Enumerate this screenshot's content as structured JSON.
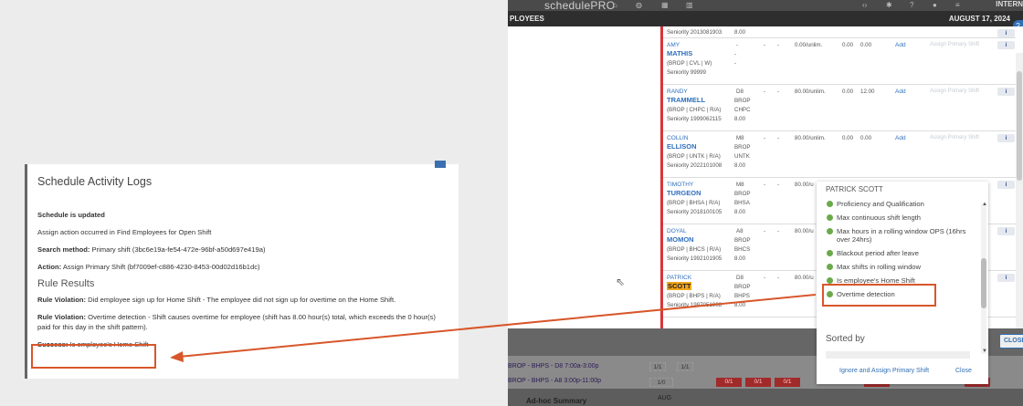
{
  "log": {
    "title": "Schedule Activity Logs",
    "updated": "Schedule is updated",
    "action_note": "Assign action occurred in Find Employees for Open Shift",
    "search_method_label": "Search method:",
    "search_method_value": "Primary shift (3bc6e19a-fe54-472e-96bf-a50d697e419a)",
    "action_label": "Action:",
    "action_value": "Assign Primary Shift (bf7009ef-c886-4230-8453-00d02d16b1dc)",
    "rule_results": "Rule Results",
    "v1_label": "Rule Violation:",
    "v1_text": "Did employee sign up for Home Shift - The employee did not sign up for overtime on the Home Shift.",
    "v2_label": "Rule Violation:",
    "v2_text": "Overtime detection - Shift causes overtime for employee (shift has 8.00 hour(s) total, which exceeds the 0 hour(s) paid for this day in the shift pattern).",
    "success_label": "Success:",
    "success_text": "Is employee's Home Shift"
  },
  "app": {
    "logo": "schedulePRO",
    "internal": "INTERN",
    "left_header": "PLOYEES",
    "date": "AUGUST 17, 2024",
    "help": "?"
  },
  "rows": [
    {
      "first": "",
      "last": "",
      "meta1": "Seniority 2013081903",
      "meta2": "",
      "c1": "",
      "c2": "8.00",
      "c3": "",
      "hours": "",
      "v1": "",
      "v2": "",
      "show_add": false
    },
    {
      "first": "AMY",
      "last": "MATHIS",
      "meta1": "(BROP | CVL | W)",
      "meta2": "Seniority 99999",
      "c1": "-",
      "c2": "-",
      "c3": "-",
      "hours": "0.00/unlim.",
      "v1": "0.00",
      "v2": "0.00",
      "show_add": true
    },
    {
      "first": "RANDY",
      "last": "TRAMMELL",
      "meta1": "(BROP | CHPC | R/A)",
      "meta2": "Seniority 1999062115",
      "c1": "D8",
      "c2": "BROP",
      "c3": "CHPC",
      "c4": "8.00",
      "hours": "80.00/unlim.",
      "v1": "0.00",
      "v2": "12.00",
      "show_add": true
    },
    {
      "first": "COLLIN",
      "last": "ELLISON",
      "meta1": "(BROP | UNTK | R/A)",
      "meta2": "Seniority 2022101008",
      "c1": "M8",
      "c2": "BROP",
      "c3": "UNTK",
      "c4": "8.00",
      "hours": "80.00/unlim.",
      "v1": "0.00",
      "v2": "0.00",
      "show_add": true
    },
    {
      "first": "TIMOTHY",
      "last": "TURGEON",
      "meta1": "(BROP | BHSA | R/A)",
      "meta2": "Seniority 2018100105",
      "c1": "M8",
      "c2": "BROP",
      "c3": "BHSA",
      "c4": "8.00",
      "hours": "80.00/u",
      "v1": "",
      "v2": "",
      "show_add": false
    },
    {
      "first": "DOYAL",
      "last": "MOMON",
      "meta1": "(BROP | BHCS | R/A)",
      "meta2": "Seniority 1992101905",
      "c1": "A8",
      "c2": "BROP",
      "c3": "BHCS",
      "c4": "8.00",
      "hours": "80.00/u",
      "v1": "",
      "v2": "",
      "show_add": false
    },
    {
      "first": "PATRICK",
      "last": "SCOTT",
      "meta1": "(BROP | BHPS | R/A)",
      "meta2": "Seniority 1997051908",
      "c1": "D8",
      "c2": "BROP",
      "c3": "BHPS",
      "c4": "8.00",
      "hours": "80.00/u",
      "v1": "",
      "v2": "",
      "show_add": false
    }
  ],
  "row_labels": {
    "add": "Add",
    "assign": "Assign Primary Shift",
    "info": "i"
  },
  "popup": {
    "title": "PATRICK SCOTT",
    "items": [
      "Proficiency and Qualification",
      "Max continuous shift length",
      "Max hours in a rolling window OPS (16hrs over 24hrs)",
      "Blackout period after leave",
      "Max shifts in rolling window",
      "Is employee's Home Shift",
      "Overtime detection"
    ],
    "sorted_by": "Sorted by",
    "ignore_btn": "Ignore and Assign Primary Shift",
    "close_btn": "Close"
  },
  "gantt": {
    "row1": "BROP - BHPS - D8 7:00a-3:00p",
    "row2": "BROP - BHPS - A8 3:00p-11:00p",
    "c11": "1/1",
    "c12": "1/1",
    "c13": "1/1",
    "c21": "1/0",
    "r1": "0/1",
    "r2": "0/1",
    "r3": "0/1",
    "r4": "0/1",
    "r5": "0/1",
    "adhoc": "Ad-hoc Summary",
    "aug": "AUG",
    "close": "CLOSE"
  }
}
